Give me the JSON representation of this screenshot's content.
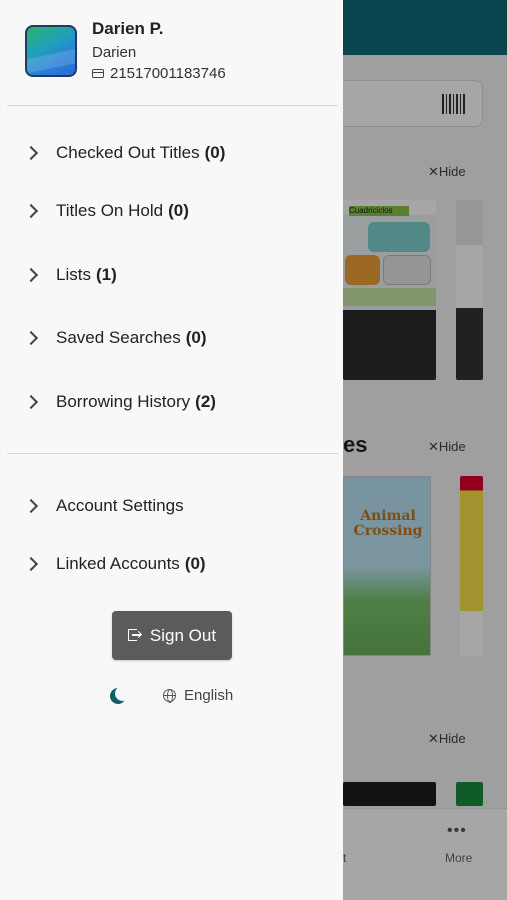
{
  "profile": {
    "name": "Darien P.",
    "library": "Darien",
    "card_number": "21517001183746"
  },
  "menu_primary": [
    {
      "label": "Checked Out Titles",
      "count": "(0)"
    },
    {
      "label": "Titles On Hold",
      "count": "(0)"
    },
    {
      "label": "Lists",
      "count": "(1)"
    },
    {
      "label": "Saved Searches",
      "count": "(0)"
    },
    {
      "label": "Borrowing History",
      "count": "(2)"
    }
  ],
  "menu_secondary": [
    {
      "label": "Account Settings",
      "count": ""
    },
    {
      "label": "Linked Accounts",
      "count": "(0)"
    }
  ],
  "sign_out_label": "Sign Out",
  "language_label": "English",
  "background": {
    "hide_label": "Hide",
    "section_fragment": "es",
    "cover_title": "Animal Crossing",
    "cover_cars_text": "Cuadriciclos",
    "tab_more_label": "More",
    "tab_fragment": "t"
  },
  "colors": {
    "header_teal": "#0f6b78",
    "moon_teal": "#0f5f6e",
    "sign_out_bg": "#5b5b5b"
  }
}
